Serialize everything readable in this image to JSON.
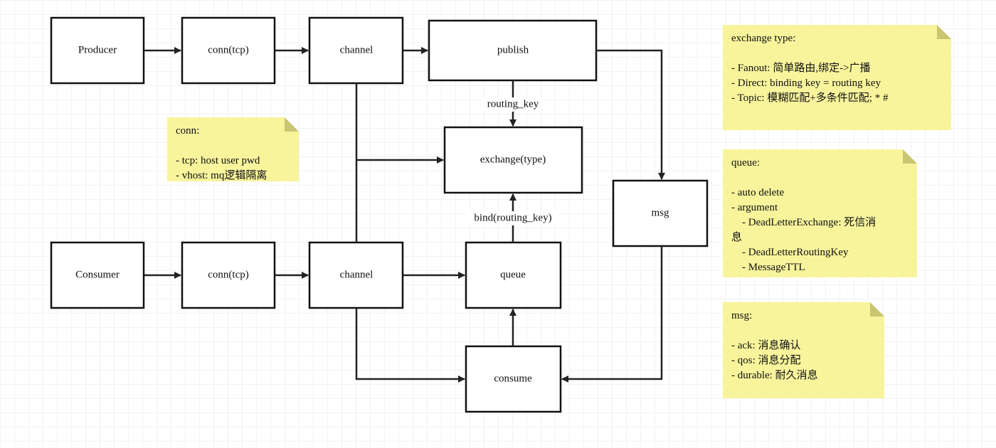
{
  "colors": {
    "note": "#f8f49c",
    "note_fold": "#c9c570",
    "grid": "#e6e6e6",
    "stroke": "#111111"
  },
  "nodes": {
    "producer": "Producer",
    "conn_p": "conn(tcp)",
    "channel_p": "channel",
    "publish": "publish",
    "exchange": "exchange(type)",
    "msg": "msg",
    "consumer": "Consumer",
    "conn_c": "conn(tcp)",
    "channel_c": "channel",
    "queue": "queue",
    "consume": "consume"
  },
  "edge_labels": {
    "routing_key": "routing_key",
    "bind": "bind(routing_key)"
  },
  "notes": {
    "conn": [
      "conn:",
      "",
      "- tcp: host user pwd",
      "- vhost: mq逻辑隔离"
    ],
    "exchange_type": [
      "exchange type:",
      "",
      "- Fanout: 简单路由,绑定->广播",
      "- Direct: binding key = routing key",
      "- Topic: 模糊匹配+多条件匹配; * #"
    ],
    "queue": [
      "queue:",
      "",
      "- auto delete",
      "- argument",
      "    - DeadLetterExchange: 死信消",
      "息",
      "    - DeadLetterRoutingKey",
      "    - MessageTTL"
    ],
    "msg": [
      "msg:",
      "",
      "- ack: 消息确认",
      "- qos: 消息分配",
      "- durable: 耐久消息"
    ]
  }
}
